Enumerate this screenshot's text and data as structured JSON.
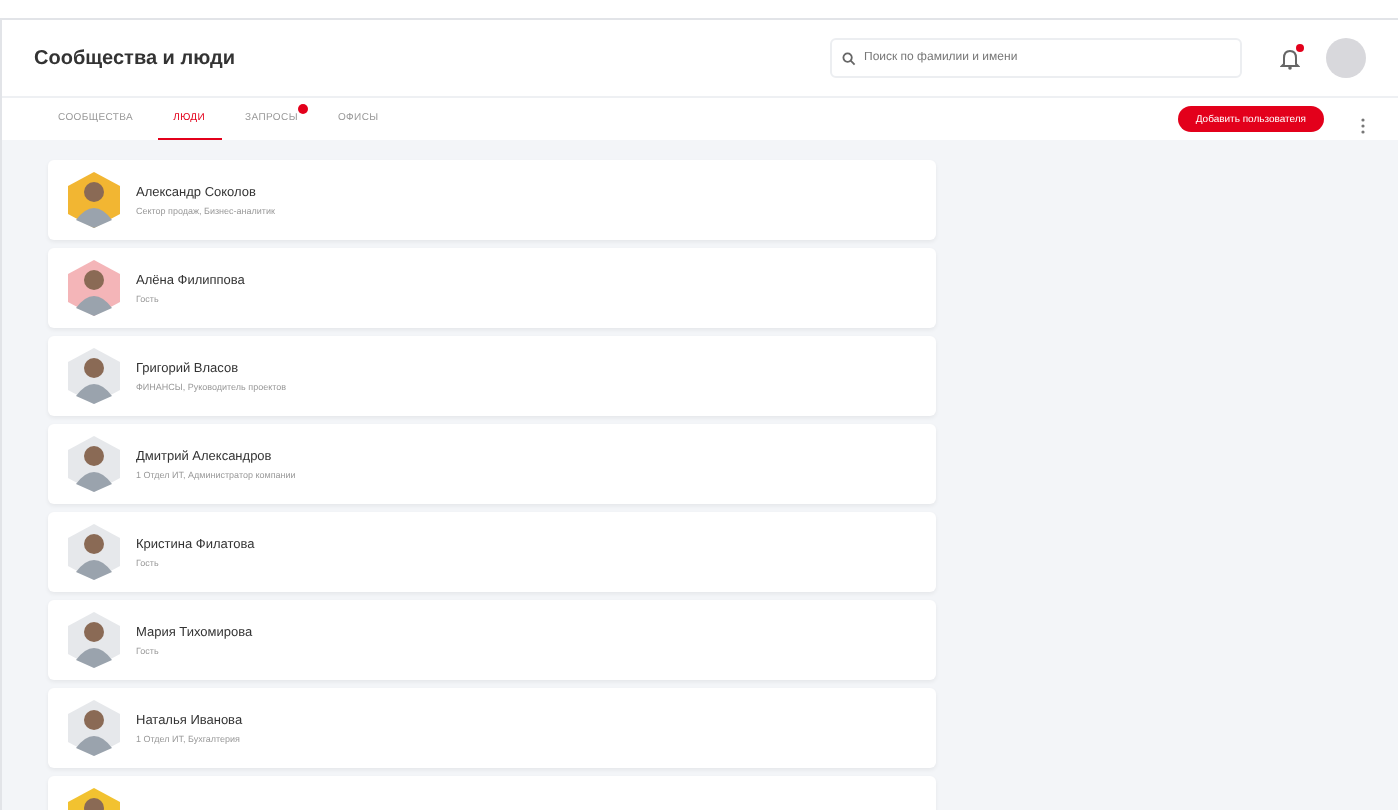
{
  "header": {
    "title": "Сообщества и люди",
    "search": {
      "placeholder": "Поиск по фамилии и имени"
    },
    "notifications": {
      "unread": true
    }
  },
  "tabs": [
    {
      "label": "СООБЩЕСТВА",
      "selected": false,
      "badge": false
    },
    {
      "label": "ЛЮДИ",
      "selected": true,
      "badge": false
    },
    {
      "label": "ЗАПРОСЫ",
      "selected": false,
      "badge": true
    },
    {
      "label": "ОФИСЫ",
      "selected": false,
      "badge": false
    }
  ],
  "add_button": "Добавить пользователя",
  "people": [
    {
      "name": "Александр Соколов",
      "role": "Сектор продаж, Бизнес-аналитик",
      "color": "#f2b632"
    },
    {
      "name": "Алёна Филиппова",
      "role": "Гость",
      "color": "#f4b5b8"
    },
    {
      "name": "Григорий Власов",
      "role": "ФИНАНСЫ, Руководитель проектов",
      "color": "#e6e8eb"
    },
    {
      "name": "Дмитрий Александров",
      "role": "1 Отдел ИТ, Администратор компании",
      "color": "#e6e8eb"
    },
    {
      "name": "Кристина Филатова",
      "role": "Гость",
      "color": "#e6e8eb"
    },
    {
      "name": "Мария Тихомирова",
      "role": "Гость",
      "color": "#e6e8eb"
    },
    {
      "name": "Наталья Иванова",
      "role": "1 Отдел ИТ, Бухгалтерия",
      "color": "#e6e8eb"
    },
    {
      "color": "#f2c230"
    }
  ]
}
